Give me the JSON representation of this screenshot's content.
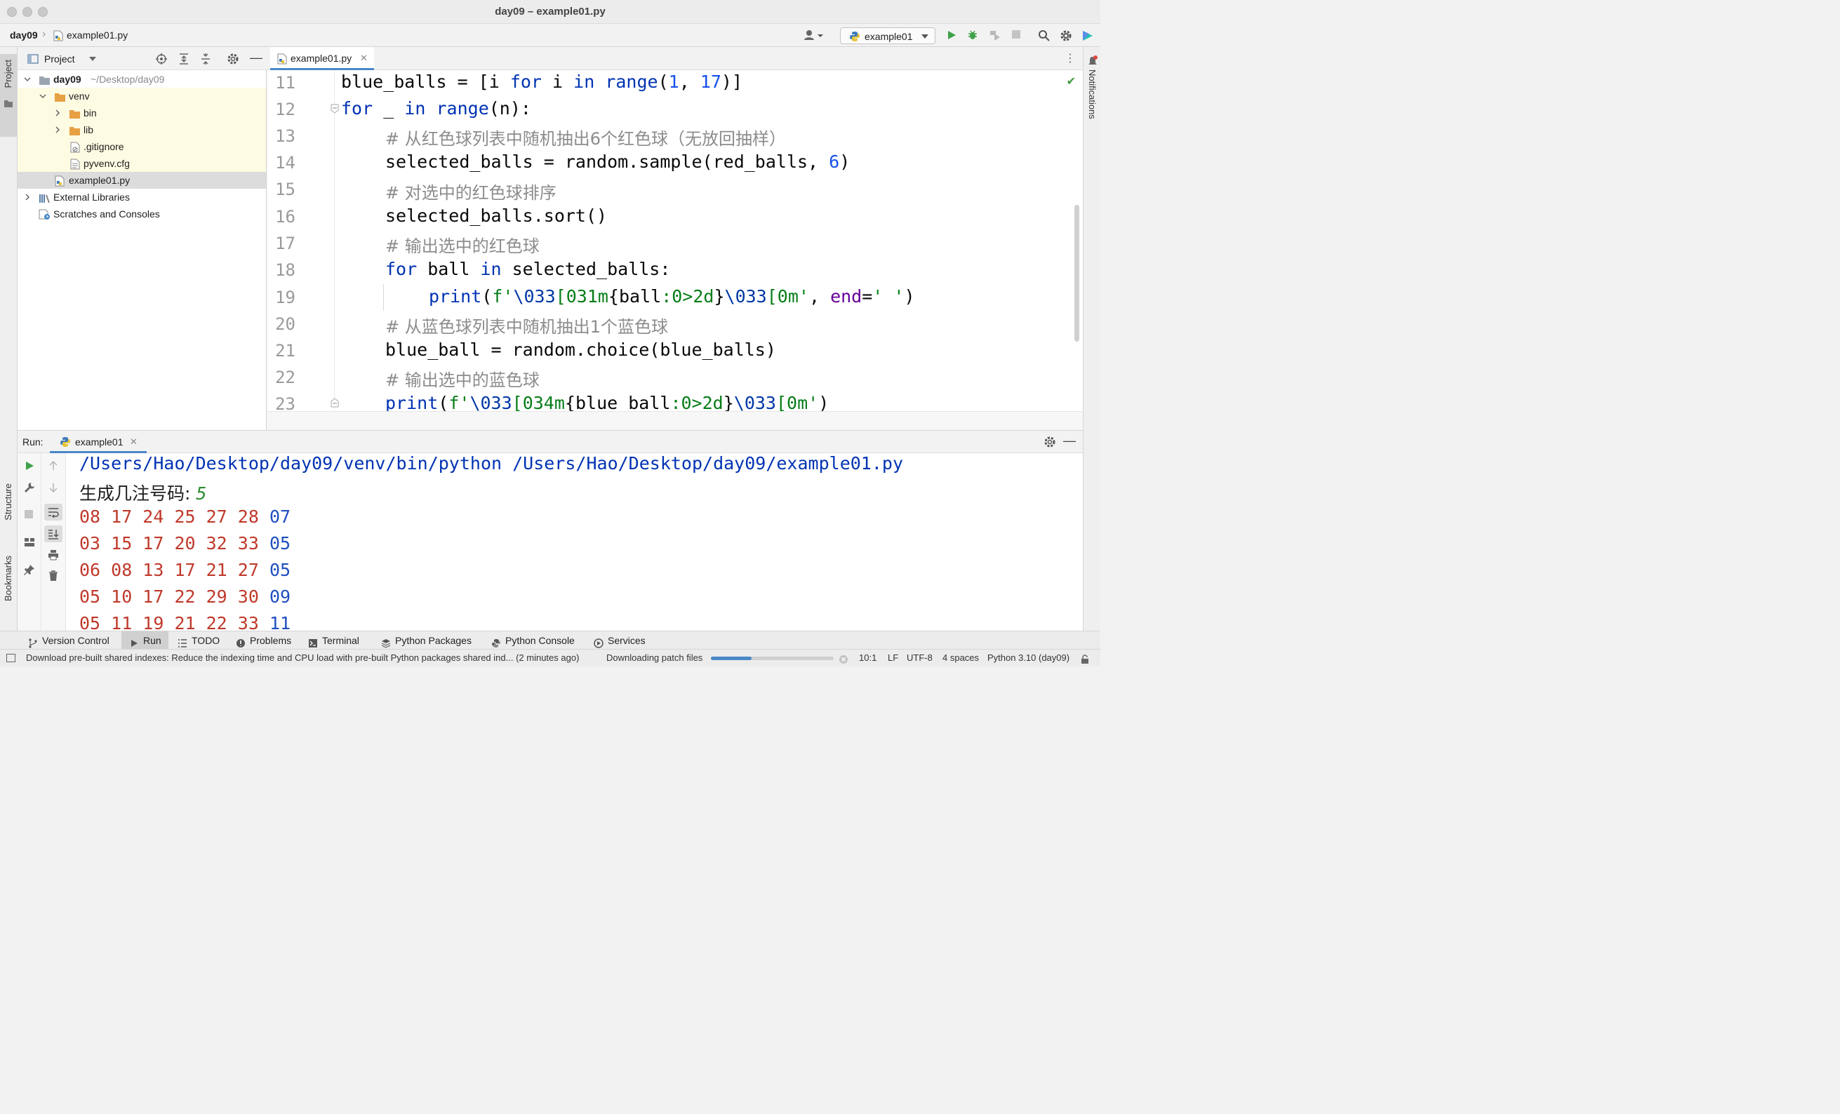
{
  "window": {
    "title": "day09 – example01.py"
  },
  "navbar": {
    "crumb_root": "day09",
    "crumb_file": "example01.py",
    "run_config": "example01"
  },
  "stripes": {
    "project": "Project",
    "structure": "Structure",
    "bookmarks": "Bookmarks",
    "notifications": "Notifications"
  },
  "project": {
    "header": "Project",
    "tree": [
      {
        "label": "day09",
        "hint": "~/Desktop/day09"
      },
      {
        "label": "venv"
      },
      {
        "label": "bin"
      },
      {
        "label": "lib"
      },
      {
        "label": ".gitignore"
      },
      {
        "label": "pyvenv.cfg"
      },
      {
        "label": "example01.py"
      },
      {
        "label": "External Libraries"
      },
      {
        "label": "Scratches and Consoles"
      }
    ]
  },
  "editor": {
    "tab": "example01.py",
    "line_numbers": [
      "11",
      "12",
      "13",
      "14",
      "15",
      "16",
      "17",
      "18",
      "19",
      "20",
      "21",
      "22",
      "23"
    ],
    "code": {
      "l11": {
        "a": "blue_balls = [i ",
        "kw1": "for",
        "b": " i ",
        "kw2": "in",
        "c": " ",
        "fn": "range",
        "d": "(",
        "n1": "1",
        "e": ", ",
        "n2": "17",
        "f": ")]"
      },
      "l12": {
        "kw1": "for",
        "a": " _ ",
        "kw2": "in",
        "b": " ",
        "fn": "range",
        "c": "(n):"
      },
      "l13": {
        "text": "# 从红色球列表中随机抽出6个红色球（无放回抽样）"
      },
      "l14": {
        "a": "selected_balls = random.sample(red_balls, ",
        "n": "6",
        "b": ")"
      },
      "l15": {
        "text": "# 对选中的红色球排序"
      },
      "l16": {
        "text": "selected_balls.sort()"
      },
      "l17": {
        "text": "# 输出选中的红色球"
      },
      "l18": {
        "kw1": "for",
        "a": " ball ",
        "kw2": "in",
        "b": " selected_balls:"
      },
      "l19": {
        "fn": "print",
        "a": "(",
        "s1": "f'",
        "e1": "\\033",
        "s2": "[031m",
        "b": "{ball",
        "f1": ":0>2d",
        "c": "}",
        "e2": "\\033",
        "s3": "[0m'",
        "d": ", ",
        "kw": "end",
        "g": "=",
        "s4": "' '",
        "h": ")"
      },
      "l20": {
        "text": "# 从蓝色球列表中随机抽出1个蓝色球"
      },
      "l21": {
        "text": "blue_ball = random.choice(blue_balls)"
      },
      "l22": {
        "text": "# 输出选中的蓝色球"
      },
      "l23": {
        "fn": "print",
        "a": "(",
        "s1": "f'",
        "e1": "\\033",
        "s2": "[034m",
        "b": "{blue_ball",
        "f1": ":0>2d",
        "c": "}",
        "e2": "\\033",
        "s3": "[0m'",
        "d": ")"
      }
    }
  },
  "run": {
    "label": "Run:",
    "tab": "example01",
    "command": "/Users/Hao/Desktop/day09/venv/bin/python /Users/Hao/Desktop/day09/example01.py",
    "prompt": "生成几注号码: ",
    "input": "5",
    "rows": [
      {
        "red": "08 17 24 25 27 28",
        "blue": "07"
      },
      {
        "red": "03 15 17 20 32 33",
        "blue": "05"
      },
      {
        "red": "06 08 13 17 21 27",
        "blue": "05"
      },
      {
        "red": "05 10 17 22 29 30",
        "blue": "09"
      },
      {
        "red": "05 11 19 21 22 33",
        "blue": "11"
      }
    ]
  },
  "tool_windows": [
    "Version Control",
    "Run",
    "TODO",
    "Problems",
    "Terminal",
    "Python Packages",
    "Python Console",
    "Services"
  ],
  "status": {
    "message": "Download pre-built shared indexes: Reduce the indexing time and CPU load with pre-built Python packages shared ind... (2 minutes ago)",
    "task": "Downloading patch files",
    "progress": 0.33,
    "position": "10:1",
    "line_sep": "LF",
    "encoding": "UTF-8",
    "indent": "4 spaces",
    "interpreter": "Python 3.10 (day09)"
  },
  "colors": {
    "accent": "#4a88c7",
    "keyword": "#0033b3",
    "comment": "#8c8c8c",
    "string": "#067d17",
    "number": "#1750eb",
    "console_red": "#c0392b",
    "console_blue": "#1f4fbf"
  }
}
